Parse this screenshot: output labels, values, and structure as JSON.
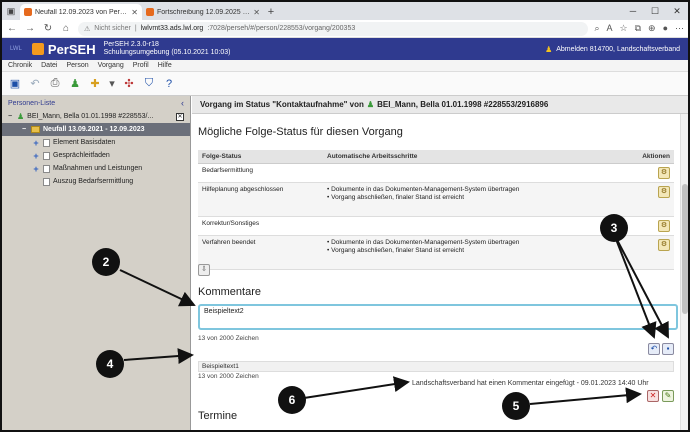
{
  "browser": {
    "tabs": [
      {
        "label": "Neufall 12.09.2023 von Person #",
        "active": true
      },
      {
        "label": "Fortschreibung 12.09.2025 von f",
        "active": false
      }
    ],
    "address": {
      "security": "Nicht sicher",
      "host": "lwlvmt33.ads.lwl.org",
      "path": ":7028/perseh/#/person/228553/vorgang/200353"
    }
  },
  "app": {
    "logo_small": "LWL",
    "name": "PerSEH",
    "version": "PerSEH 2.3.0-r18",
    "environment": "Schulungsumgebung (05.10.2021 10:03)",
    "user_text": "Abmelden 814700, Landschaftsverband"
  },
  "menu": [
    "Chronik",
    "Datei",
    "Person",
    "Vorgang",
    "Profil",
    "Hilfe"
  ],
  "leftpanel": {
    "title": "Personen-Liste",
    "person": "BEI_Mann, Bella 01.01.1998 #228553/...",
    "case": "Neufall 13.09.2021 - 12.09.2023",
    "items": [
      {
        "label": "Element Basisdaten",
        "expandable": true
      },
      {
        "label": "Gesprächleitfaden",
        "expandable": true
      },
      {
        "label": "Maßnahmen und Leistungen",
        "expandable": true
      },
      {
        "label": "Auszug Bedarfsermittlung",
        "expandable": false
      }
    ]
  },
  "content": {
    "title_prefix": "Vorgang im Status \"Kontaktaufnahme\" von",
    "title_person": "BEI_Mann, Bella 01.01.1998 #228553/2916896",
    "section_status": "Mögliche Folge-Status für diesen Vorgang",
    "table_headers": [
      "Folge-Status",
      "Automatische Arbeitsschritte",
      "Aktionen"
    ],
    "rows": [
      {
        "status": "Bedarfsermittlung",
        "steps": []
      },
      {
        "status": "Hilfeplanung abgeschlossen",
        "steps": [
          "Dokumente in das Dokumenten-Management-System übertragen",
          "Vorgang abschließen, finaler Stand ist erreicht"
        ]
      },
      {
        "status": "Korrektur/Sonstiges",
        "steps": []
      },
      {
        "status": "Verfahren beendet",
        "steps": [
          "Dokumente in das Dokumenten-Management-System übertragen",
          "Vorgang abschließen, finaler Stand ist erreicht"
        ]
      }
    ],
    "section_comments": "Kommentare",
    "comment_input_value": "Beispieltext2",
    "comment_input_count": "13 von 2000 Zeichen",
    "comment_saved_value": "Beispieltext1",
    "comment_saved_count": "13 von 2000 Zeichen",
    "comment_meta": "Landschaftsverband hat einen Kommentar eingefügt - 09.01.2023 14:40 Uhr",
    "section_termine": "Termine"
  },
  "annotations": [
    "2",
    "3",
    "4",
    "5",
    "6"
  ]
}
